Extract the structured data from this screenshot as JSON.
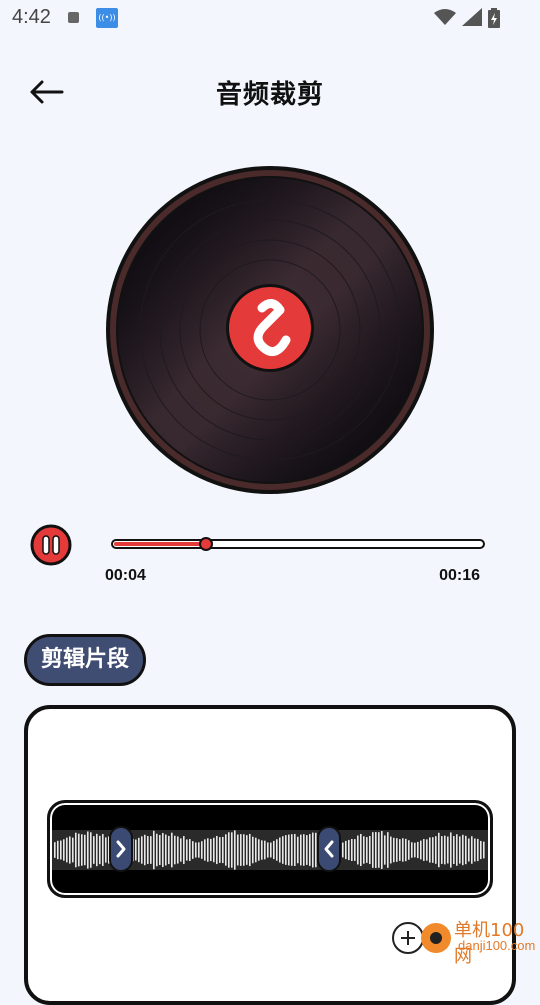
{
  "status_bar": {
    "time": "4:42"
  },
  "header": {
    "title": "音频裁剪"
  },
  "player": {
    "current_time": "00:04",
    "total_time": "00:16",
    "progress_fraction": 0.25
  },
  "editor": {
    "section_label": "剪辑片段"
  },
  "watermark": {
    "cn": "单机100网",
    "en": "danji100.com"
  },
  "colors": {
    "accent_red": "#e53a3a",
    "handle_blue": "#3b4a72",
    "background": "#f3f7fd"
  }
}
